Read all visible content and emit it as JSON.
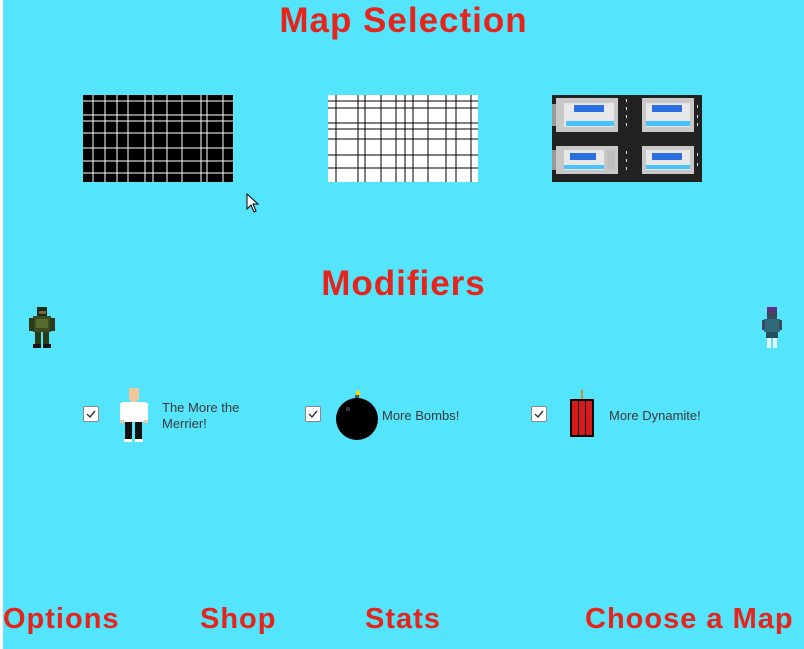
{
  "title": "Map Selection",
  "maps": [
    {
      "name": "map-dark-grid",
      "icon": "dark-grid-map-icon"
    },
    {
      "name": "map-light-grid",
      "icon": "light-grid-map-icon"
    },
    {
      "name": "map-city",
      "icon": "city-map-icon"
    }
  ],
  "modifiers_title": "Modifiers",
  "modifiers": [
    {
      "label": "The More the Merrier!",
      "checked": true,
      "icon": "person-icon"
    },
    {
      "label": "More Bombs!",
      "checked": true,
      "icon": "bomb-icon"
    },
    {
      "label": "More Dynamite!",
      "checked": true,
      "icon": "dynamite-icon"
    }
  ],
  "nav": {
    "options": "Options",
    "shop": "Shop",
    "stats": "Stats",
    "choose_map": "Choose a Map"
  },
  "colors": {
    "background": "#54e4fb",
    "heading": "#e5241c"
  }
}
